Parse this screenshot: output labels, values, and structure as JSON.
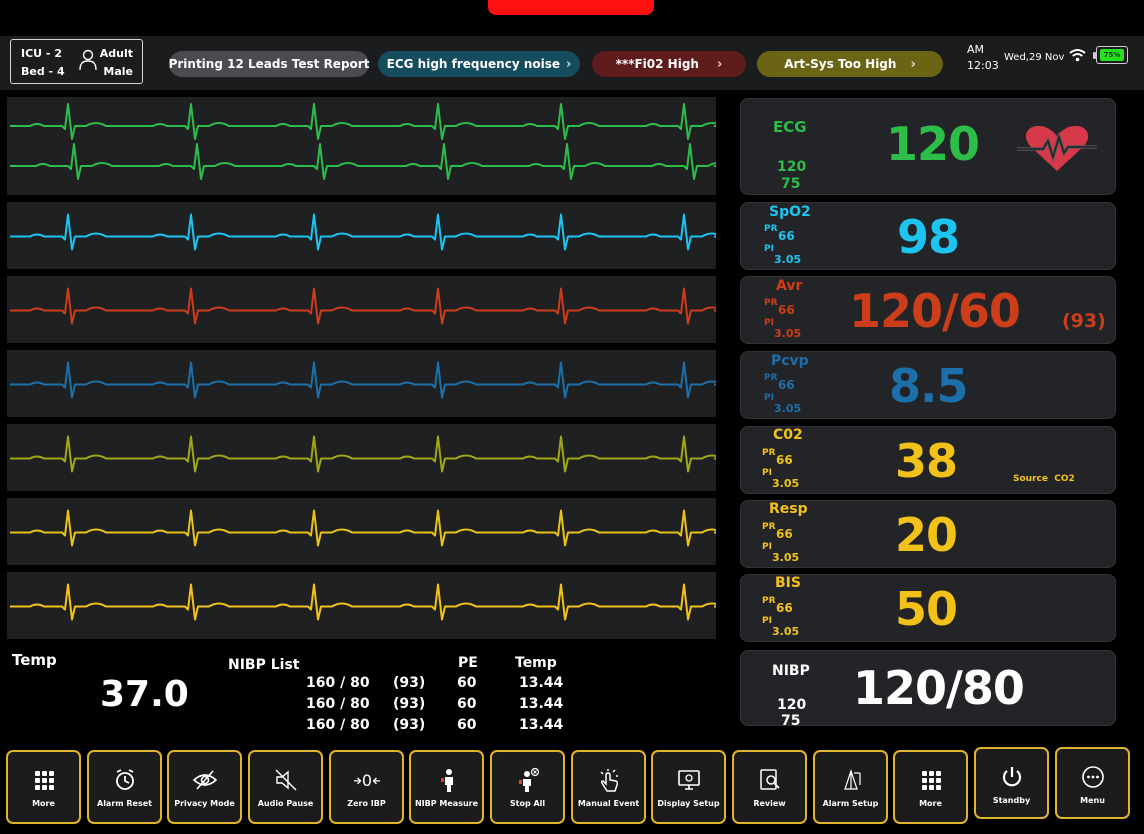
{
  "header": {
    "unit": "ICU - 2",
    "bed": "Bed - 4",
    "patient_type": "Adult",
    "patient_sex": "Male",
    "alerts": [
      {
        "label": "Printing 12 Leads Test Report",
        "bg": "#4a4b4e",
        "color": "#ffffff"
      },
      {
        "label": "ECG high frequency noise",
        "bg": "#164d5e",
        "color": "#ffffff"
      },
      {
        "label": "***Fi02 High",
        "bg": "#5e1c1c",
        "color": "#ffffff"
      },
      {
        "label": "Art-Sys Too High",
        "bg": "#6b6414",
        "color": "#ffffff"
      }
    ],
    "ampm": "AM",
    "time": "12:03",
    "date": "Wed,29 Nov",
    "battery": "75%"
  },
  "waves": [
    {
      "color": "#2dbe4a",
      "leads": 2
    },
    {
      "color": "#1ec4f0",
      "leads": 1
    },
    {
      "color": "#cc3d1a",
      "leads": 1
    },
    {
      "color": "#1c6fa8",
      "leads": 1
    },
    {
      "color": "#a0a616",
      "leads": 1
    },
    {
      "color": "#e8c21a",
      "leads": 1
    },
    {
      "color": "#f2c21a",
      "leads": 1
    }
  ],
  "params": {
    "ecg": {
      "label": "ECG",
      "hi": "120",
      "lo": "75",
      "value": "120",
      "color": "#2dbe4a"
    },
    "spo2": {
      "label": "SpO2",
      "pr_label": "PR",
      "pr": "66",
      "pi_label": "PI",
      "pi": "3.05",
      "value": "98",
      "color": "#1ec4f0"
    },
    "avr": {
      "label": "Avr",
      "pr_label": "PR",
      "pr": "66",
      "pi_label": "PI",
      "pi": "3.05",
      "value": "120/60",
      "mean": "(93)",
      "color": "#cc3d1a"
    },
    "pcvp": {
      "label": "Pcvp",
      "pr_label": "PR",
      "pr": "66",
      "pi_label": "PI",
      "pi": "3.05",
      "value": "8.5",
      "color": "#1c6fa8"
    },
    "co2": {
      "label": "C02",
      "pr_label": "PR",
      "pr": "66",
      "pi_label": "PI",
      "pi": "3.05",
      "value": "38",
      "source": "Source  CO2",
      "color": "#f2c21a"
    },
    "resp": {
      "label": "Resp",
      "pr_label": "PR",
      "pr": "66",
      "pi_label": "PI",
      "pi": "3.05",
      "value": "20",
      "color": "#f2c21a"
    },
    "bis": {
      "label": "BIS",
      "pr_label": "PR",
      "pr": "66",
      "pi_label": "PI",
      "pi": "3.05",
      "value": "50",
      "color": "#f2c21a"
    },
    "nibp": {
      "label": "NIBP",
      "hi": "120",
      "lo": "75",
      "value": "120/80",
      "color": "#ffffff"
    }
  },
  "temp": {
    "label": "Temp",
    "value": "37.0"
  },
  "nibp_list": {
    "title": "NIBP List",
    "col_pe": "PE",
    "col_temp": "Temp",
    "rows": [
      {
        "bp": "160 / 80",
        "mean": "(93)",
        "pe": "60",
        "temp": "13.44"
      },
      {
        "bp": "160 / 80",
        "mean": "(93)",
        "pe": "60",
        "temp": "13.44"
      },
      {
        "bp": "160 / 80",
        "mean": "(93)",
        "pe": "60",
        "temp": "13.44"
      }
    ]
  },
  "toolbar": [
    {
      "label": "More",
      "icon": "grid-icon"
    },
    {
      "label": "Alarm Reset",
      "icon": "alarm-reset-icon"
    },
    {
      "label": "Privacy Mode",
      "icon": "eye-off-icon"
    },
    {
      "label": "Audio Pause",
      "icon": "mute-icon"
    },
    {
      "label": "Zero IBP",
      "icon": "zero-icon"
    },
    {
      "label": "NIBP Measure",
      "icon": "person-cuff-icon"
    },
    {
      "label": "Stop All",
      "icon": "stop-person-icon"
    },
    {
      "label": "Manual Event",
      "icon": "hand-tap-icon"
    },
    {
      "label": "Display Setup",
      "icon": "display-icon"
    },
    {
      "label": "Review",
      "icon": "review-icon"
    },
    {
      "label": "Alarm Setup",
      "icon": "alarm-setup-icon"
    },
    {
      "label": "More",
      "icon": "grid-icon"
    },
    {
      "label": "Standby",
      "icon": "power-icon"
    },
    {
      "label": "Menu",
      "icon": "menu-dots-icon"
    }
  ]
}
